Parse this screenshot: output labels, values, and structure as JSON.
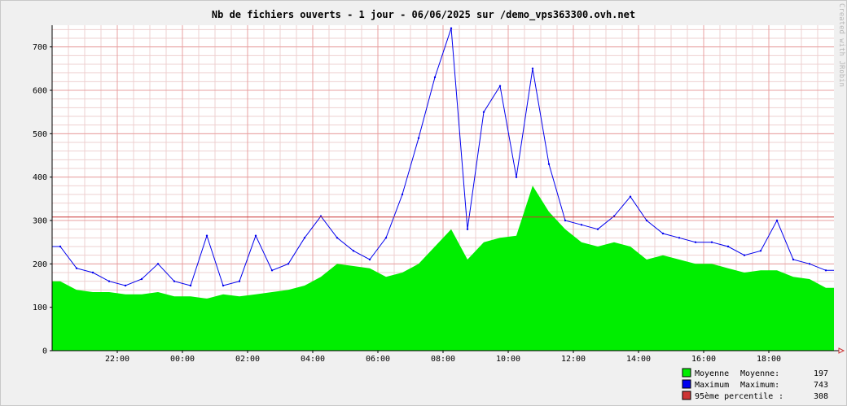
{
  "title": "Nb de fichiers ouverts - 1 jour - 06/06/2025 sur /demo_vps363300.ovh.net",
  "watermark": "Created with JRobin",
  "colors": {
    "background": "#f0f0f0",
    "plot_background": "#ffffff",
    "major_grid": "#e8a0a0",
    "minor_grid": "#eed0d0",
    "average_fill": "#00ee00",
    "maximum_line": "#0000ee",
    "percentile_line": "#cc3333",
    "axis": "#000000"
  },
  "legend": [
    {
      "swatch_color": "#00ee00",
      "label": "Moyenne",
      "stat_label": "Moyenne:",
      "value": "197"
    },
    {
      "swatch_color": "#0000ee",
      "label": "Maximum",
      "stat_label": "Maximum:",
      "value": "743"
    },
    {
      "swatch_color": "#cc3333",
      "label": "95ème percentile",
      "stat_label": ":",
      "value": "308"
    }
  ],
  "chart_data": {
    "type": "area",
    "title": "Nb de fichiers ouverts - 1 jour - 06/06/2025 sur /demo_vps363300.ovh.net",
    "xlabel": "",
    "ylabel": "",
    "x_range": [
      "2025-06-05T20:00",
      "2025-06-06T20:00"
    ],
    "ylim": [
      0,
      750
    ],
    "y_ticks": [
      0,
      100,
      200,
      300,
      400,
      500,
      600,
      700
    ],
    "x_tick_labels": [
      "22:00",
      "00:00",
      "02:00",
      "04:00",
      "06:00",
      "08:00",
      "10:00",
      "12:00",
      "14:00",
      "16:00",
      "18:00"
    ],
    "grid": true,
    "legend_position": "bottom-right",
    "percentile_95": 308,
    "x": [
      "20:00",
      "20:30",
      "21:00",
      "21:30",
      "22:00",
      "22:30",
      "23:00",
      "23:30",
      "00:00",
      "00:30",
      "01:00",
      "01:30",
      "02:00",
      "02:30",
      "03:00",
      "03:30",
      "04:00",
      "04:30",
      "05:00",
      "05:30",
      "06:00",
      "06:30",
      "07:00",
      "07:30",
      "08:00",
      "08:30",
      "09:00",
      "09:30",
      "10:00",
      "10:30",
      "11:00",
      "11:30",
      "12:00",
      "12:30",
      "13:00",
      "13:30",
      "14:00",
      "14:30",
      "15:00",
      "15:30",
      "16:00",
      "16:30",
      "17:00",
      "17:30",
      "18:00",
      "18:30",
      "19:00",
      "19:30"
    ],
    "series": [
      {
        "name": "Moyenne",
        "values": [
          160,
          140,
          135,
          135,
          130,
          130,
          135,
          125,
          125,
          120,
          130,
          125,
          130,
          135,
          140,
          150,
          170,
          200,
          195,
          190,
          170,
          180,
          200,
          240,
          280,
          210,
          250,
          260,
          265,
          380,
          320,
          280,
          250,
          240,
          250,
          240,
          210,
          220,
          210,
          200,
          200,
          190,
          180,
          185,
          185,
          170,
          165,
          145
        ]
      },
      {
        "name": "Maximum",
        "values": [
          240,
          190,
          180,
          160,
          150,
          165,
          200,
          160,
          150,
          265,
          150,
          160,
          265,
          185,
          200,
          260,
          310,
          260,
          230,
          210,
          260,
          360,
          490,
          630,
          743,
          280,
          550,
          610,
          400,
          650,
          430,
          300,
          290,
          280,
          310,
          355,
          300,
          270,
          260,
          250,
          250,
          240,
          220,
          230,
          300,
          210,
          200,
          185
        ]
      }
    ]
  }
}
